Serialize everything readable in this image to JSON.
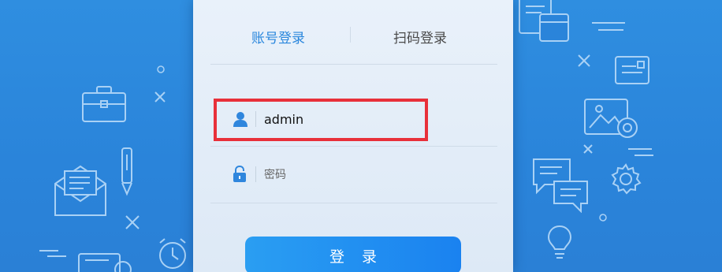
{
  "login": {
    "tabs": [
      {
        "label": "账号登录",
        "active": true
      },
      {
        "label": "扫码登录",
        "active": false
      }
    ],
    "username": {
      "value": "admin",
      "icon": "user-icon"
    },
    "password": {
      "placeholder": "密码",
      "value": "",
      "icon": "lock-icon"
    },
    "submit_label": "登录"
  },
  "colors": {
    "background": "#2a84da",
    "panel": "#e3edf8",
    "accent": "#2a87dd",
    "button": "#1a82f0",
    "highlight": "#e8303a"
  }
}
